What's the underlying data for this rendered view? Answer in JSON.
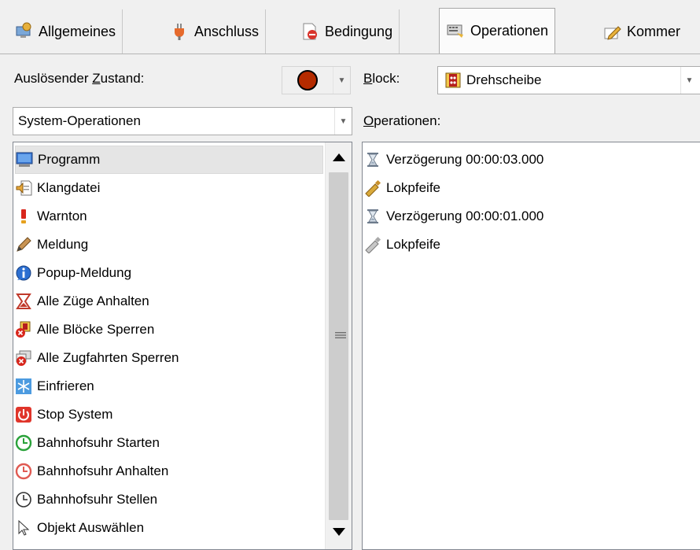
{
  "tabs": [
    {
      "label": "Allgemeines",
      "icon": "settings-pc-icon"
    },
    {
      "label": "Anschluss",
      "icon": "plug-icon"
    },
    {
      "label": "Bedingung",
      "icon": "condition-icon"
    },
    {
      "label": "Operationen",
      "icon": "operations-icon",
      "active": true
    },
    {
      "label": "Kommer",
      "icon": "comment-icon"
    }
  ],
  "trigger": {
    "label_pre": "Auslösender ",
    "label_key": "Z",
    "label_post": "ustand:",
    "color": "#b52b00"
  },
  "block": {
    "label_key": "B",
    "label_post": "lock:",
    "value": "Drehscheibe"
  },
  "category": {
    "value": "System-Operationen"
  },
  "operations_header": {
    "label_key": "O",
    "label_post": "perationen:"
  },
  "system_ops": [
    {
      "label": "Programm",
      "icon": "program-icon",
      "selected": true
    },
    {
      "label": "Klangdatei",
      "icon": "sound-file-icon"
    },
    {
      "label": "Warnton",
      "icon": "warning-icon"
    },
    {
      "label": "Meldung",
      "icon": "pencil-icon"
    },
    {
      "label": "Popup-Meldung",
      "icon": "info-icon"
    },
    {
      "label": "Alle Züge Anhalten",
      "icon": "hourglass-stop-icon"
    },
    {
      "label": "Alle Blöcke Sperren",
      "icon": "block-lock-icon"
    },
    {
      "label": "Alle Zugfahrten Sperren",
      "icon": "route-lock-icon"
    },
    {
      "label": "Einfrieren",
      "icon": "snowflake-icon"
    },
    {
      "label": "Stop System",
      "icon": "power-stop-icon"
    },
    {
      "label": "Bahnhofsuhr Starten",
      "icon": "clock-start-icon"
    },
    {
      "label": "Bahnhofsuhr Anhalten",
      "icon": "clock-stop-icon"
    },
    {
      "label": "Bahnhofsuhr Stellen",
      "icon": "clock-set-icon"
    },
    {
      "label": "Objekt Auswählen",
      "icon": "cursor-icon"
    }
  ],
  "operations": [
    {
      "label": "Verzögerung 00:00:03.000",
      "icon": "hourglass-icon"
    },
    {
      "label": "Lokpfeife",
      "icon": "whistle-icon"
    },
    {
      "label": "Verzögerung 00:00:01.000",
      "icon": "hourglass-icon"
    },
    {
      "label": "Lokpfeife",
      "icon": "whistle-gray-icon"
    }
  ]
}
